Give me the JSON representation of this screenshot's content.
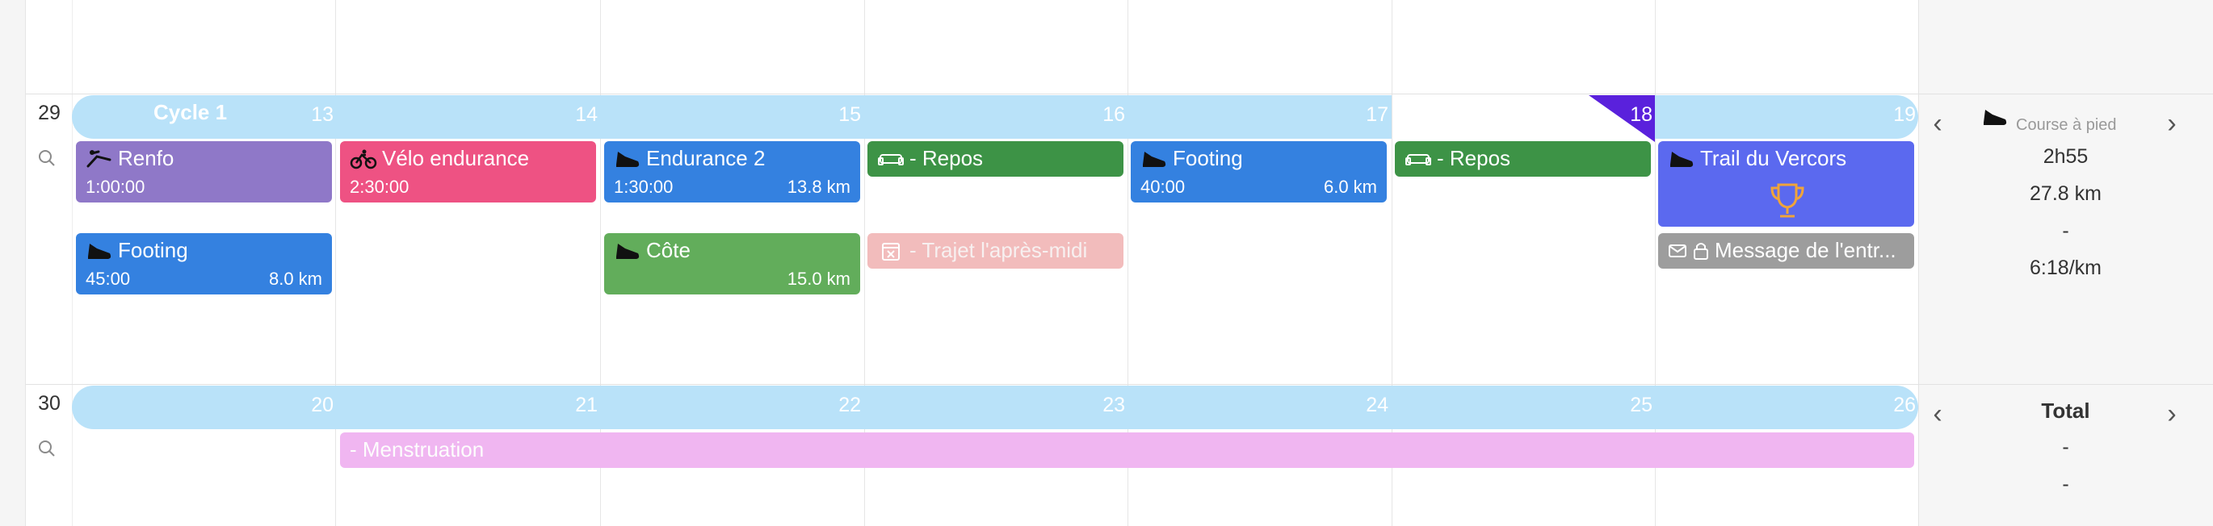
{
  "week_29": {
    "number": "29",
    "cycle_label": "Cycle 1",
    "days": [
      "13",
      "14",
      "15",
      "16",
      "17",
      "18",
      "19"
    ],
    "today": "18",
    "events": {
      "renfo": {
        "title": "Renfo",
        "duration": "1:00:00"
      },
      "velo": {
        "title": "Vélo endurance",
        "duration": "2:30:00"
      },
      "endurance2": {
        "title": "Endurance 2",
        "duration": "1:30:00",
        "distance": "13.8 km"
      },
      "repos_tue": {
        "title": "- Repos"
      },
      "footing_fri": {
        "title": "Footing",
        "duration": "40:00",
        "distance": "6.0 km"
      },
      "repos_sat": {
        "title": "- Repos"
      },
      "trail": {
        "title": "Trail du Vercors"
      },
      "footing_mon": {
        "title": "Footing",
        "duration": "45:00",
        "distance": "8.0 km"
      },
      "cote": {
        "title": "Côte",
        "distance": "15.0 km"
      },
      "trajet": {
        "title": "- Trajet l'après-midi"
      },
      "message": {
        "title": "Message de l'entr..."
      }
    },
    "summary": {
      "sport": "Course à pied",
      "time": "2h55",
      "distance": "27.8 km",
      "elevation": "-",
      "pace": "6:18/km"
    }
  },
  "week_30": {
    "number": "30",
    "days": [
      "20",
      "21",
      "22",
      "23",
      "24",
      "25",
      "26"
    ],
    "events": {
      "menstruation": {
        "title": "- Menstruation"
      }
    },
    "summary": {
      "title": "Total",
      "line1": "-",
      "line2": "-"
    }
  },
  "colors": {
    "band": "#b9e2f9",
    "today_flag": "#5a21dc",
    "renfo": "#8f78c8",
    "velo": "#ee5283",
    "run": "#3481e0",
    "rest": "#3d9346",
    "hill": "#62ad5b",
    "race": "#5b69ef",
    "trip": "#f2bcbc",
    "message": "#9d9d9d",
    "period": "#f0b6f1",
    "trophy": "#f0a43a"
  },
  "icons": [
    "search-icon",
    "strength-icon",
    "bike-icon",
    "shoe-icon",
    "sofa-icon",
    "calendar-x-icon",
    "mail-icon",
    "lock-icon",
    "trophy-icon",
    "chevron-left-icon",
    "chevron-right-icon"
  ]
}
